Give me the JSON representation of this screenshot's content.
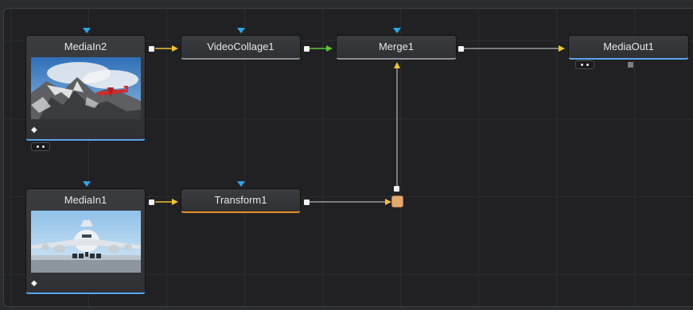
{
  "nodes": {
    "media_in2": {
      "label": "MediaIn2"
    },
    "video_collage1": {
      "label": "VideoCollage1"
    },
    "merge1": {
      "label": "Merge1"
    },
    "media_out1": {
      "label": "MediaOut1"
    },
    "media_in1": {
      "label": "MediaIn1"
    },
    "transform1": {
      "label": "Transform1"
    }
  },
  "icons": {
    "flag": "diamond-flag-icon",
    "input_port": "blue-triangle-input-icon",
    "output_port": "white-square-output-icon",
    "merge_dot": "orange-merge-connector-icon"
  },
  "colors": {
    "background": "#212124",
    "wire": "#d8d8d8",
    "arrow_yellow": "#f2c230",
    "arrow_green": "#5cc23a",
    "input_blue": "#2ea4e6",
    "underline_blue": "#5aa6e8",
    "underline_orange": "#e8922c",
    "merge_box": "#e3a972"
  }
}
